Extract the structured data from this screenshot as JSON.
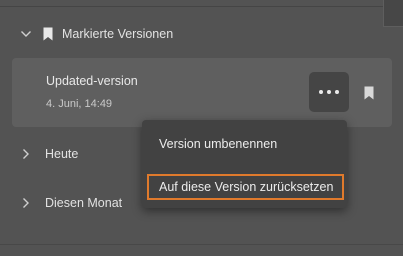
{
  "panel": {
    "marked_section": {
      "label": "Markierte Versionen",
      "expanded": true
    },
    "version": {
      "name": "Updated-version",
      "date": "4. Juni, 14:49"
    },
    "today_section": {
      "label": "Heute",
      "expanded": false
    },
    "month_section": {
      "label": "Diesen Monat",
      "expanded": false
    }
  },
  "context_menu": {
    "items": [
      {
        "label": "Version umbenennen"
      },
      {
        "label": "Auf diese Version zurücksetzen",
        "highlighted": true
      }
    ]
  },
  "icons": {
    "chevron_expanded": "chevron-down-icon",
    "chevron_collapsed": "chevron-right-icon",
    "bookmark": "bookmark-icon",
    "more": "more-horizontal-icon"
  },
  "colors": {
    "background": "#535353",
    "card": "#5f5f5f",
    "menu": "#424242",
    "highlight_border": "#e07a2c"
  }
}
